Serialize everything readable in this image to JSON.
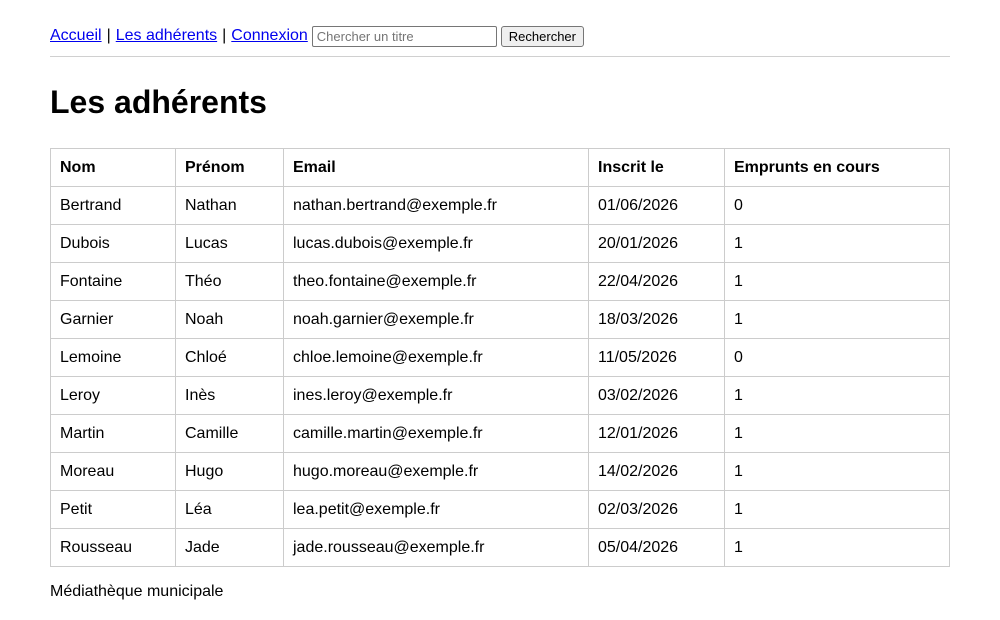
{
  "nav": {
    "home": "Accueil",
    "members": "Les adhérents",
    "login": "Connexion",
    "separator": "|",
    "search_placeholder": "Chercher un titre",
    "search_button": "Rechercher"
  },
  "page_title": "Les adhérents",
  "table": {
    "headers": [
      "Nom",
      "Prénom",
      "Email",
      "Inscrit le",
      "Emprunts en cours"
    ],
    "rows": [
      [
        "Bertrand",
        "Nathan",
        "nathan.bertrand@exemple.fr",
        "01/06/2026",
        "0"
      ],
      [
        "Dubois",
        "Lucas",
        "lucas.dubois@exemple.fr",
        "20/01/2026",
        "1"
      ],
      [
        "Fontaine",
        "Théo",
        "theo.fontaine@exemple.fr",
        "22/04/2026",
        "1"
      ],
      [
        "Garnier",
        "Noah",
        "noah.garnier@exemple.fr",
        "18/03/2026",
        "1"
      ],
      [
        "Lemoine",
        "Chloé",
        "chloe.lemoine@exemple.fr",
        "11/05/2026",
        "0"
      ],
      [
        "Leroy",
        "Inès",
        "ines.leroy@exemple.fr",
        "03/02/2026",
        "1"
      ],
      [
        "Martin",
        "Camille",
        "camille.martin@exemple.fr",
        "12/01/2026",
        "1"
      ],
      [
        "Moreau",
        "Hugo",
        "hugo.moreau@exemple.fr",
        "14/02/2026",
        "1"
      ],
      [
        "Petit",
        "Léa",
        "lea.petit@exemple.fr",
        "02/03/2026",
        "1"
      ],
      [
        "Rousseau",
        "Jade",
        "jade.rousseau@exemple.fr",
        "05/04/2026",
        "1"
      ]
    ]
  },
  "footer": "Médiathèque municipale",
  "colors": {
    "link": "#0000ee",
    "border": "#cccccc",
    "text": "#000000"
  }
}
